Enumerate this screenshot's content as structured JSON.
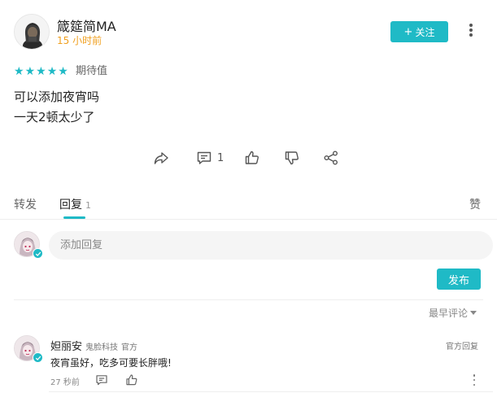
{
  "post": {
    "author_name": "箴筵简MA",
    "time": "15 小时前",
    "follow_label": "关注",
    "rating_label": "期待值",
    "stars": 5,
    "body_lines": [
      "可以添加夜宵吗",
      "一天2顿太少了"
    ],
    "comment_count": "1"
  },
  "tabs": {
    "repost": "转发",
    "reply": "回复",
    "reply_count": "1",
    "like": "赞"
  },
  "reply_box": {
    "placeholder": "添加回复",
    "publish_label": "发布",
    "sort_label": "最早评论"
  },
  "comment": {
    "user": "妲丽安",
    "org": "鬼脸科技",
    "role": "官方",
    "tag": "官方回复",
    "text": "夜宵虽好，吃多可要长胖哦!",
    "time": "27 秒前"
  },
  "colors": {
    "accent": "#1fbac6",
    "time_orange": "#f0a020"
  },
  "icons": [
    "plus-icon",
    "more-vert-icon",
    "star-icon",
    "share-arrow-icon",
    "comment-icon",
    "thumb-up-icon",
    "thumb-down-icon",
    "share-nodes-icon",
    "verified-check-icon",
    "caret-down-icon"
  ]
}
